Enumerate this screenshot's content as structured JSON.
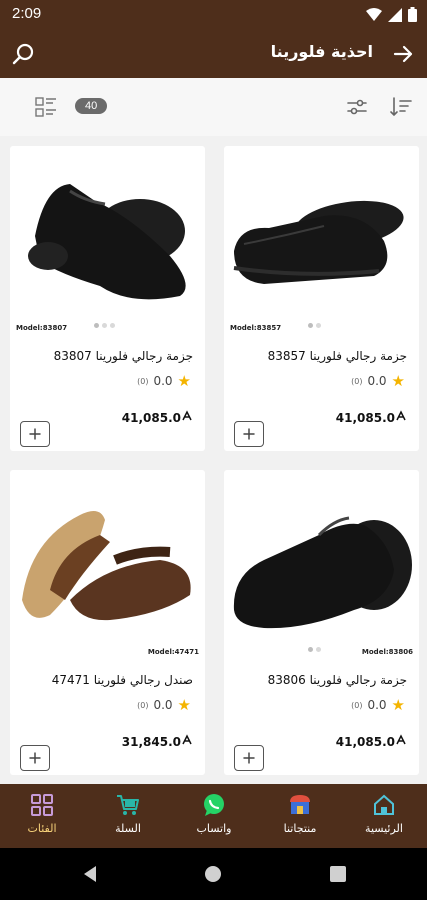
{
  "status_bar": {
    "time": "2:09"
  },
  "app_bar": {
    "title": "احذية فلورينا"
  },
  "toolbar": {
    "count": "40"
  },
  "products": [
    {
      "model": "Model:83857",
      "name": "جزمة رجالي فلورينا 83857",
      "rating": "0.0",
      "rating_count": "(0)",
      "price": "41,085.0"
    },
    {
      "model": "Model:83807",
      "name": "جزمة رجالي فلورينا 83807",
      "rating": "0.0",
      "rating_count": "(0)",
      "price": "41,085.0"
    },
    {
      "model": "Model:83806",
      "name": "جزمة رجالي فلورينا 83806",
      "rating": "0.0",
      "rating_count": "(0)",
      "price": "41,085.0"
    },
    {
      "model": "Model:47471",
      "name": "صندل رجالي فلورينا 47471",
      "rating": "0.0",
      "rating_count": "(0)",
      "price": "31,845.0"
    }
  ],
  "bottom_nav": {
    "home": "الرئيسية",
    "products": "منتجاتنا",
    "whatsapp": "واتساب",
    "cart": "السلة",
    "categories": "الفئات"
  },
  "colors": {
    "primary": "#4e2e1b",
    "active_label": "#f7d27a",
    "star": "#f4b400"
  }
}
